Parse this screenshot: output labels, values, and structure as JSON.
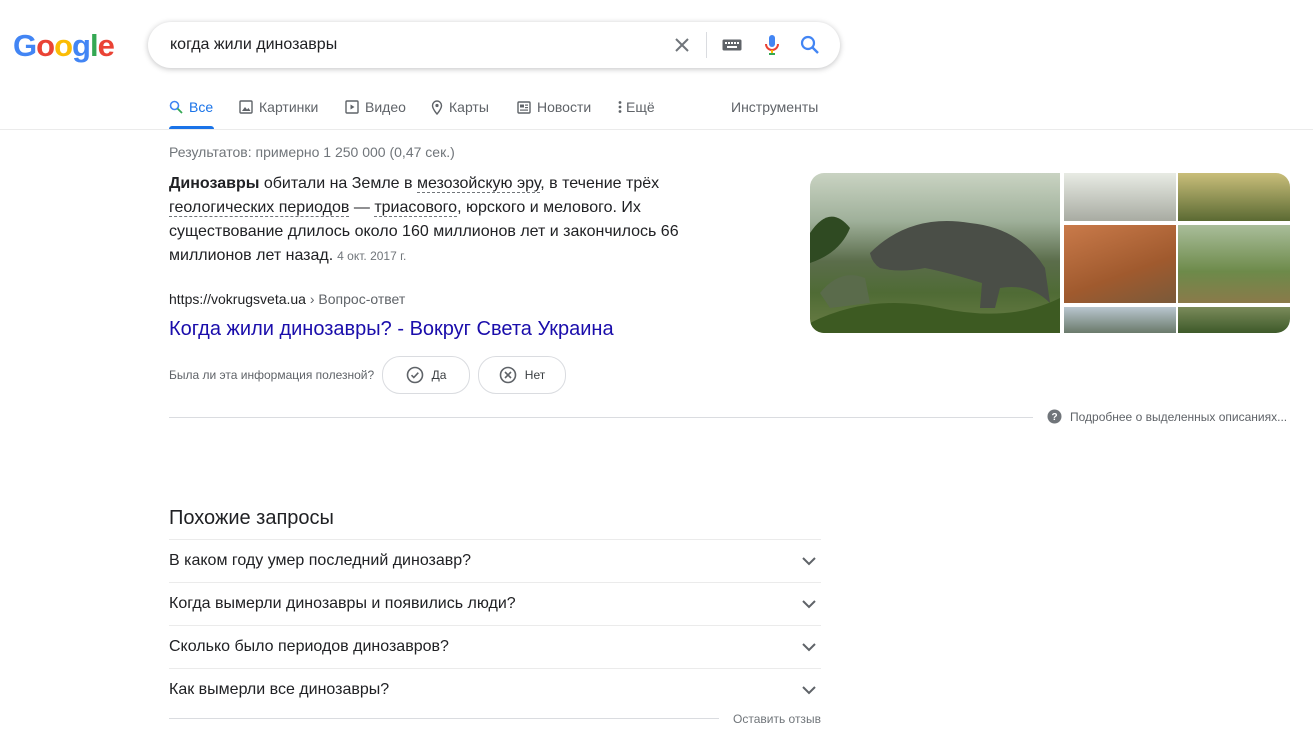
{
  "logo": {
    "letters": [
      "G",
      "o",
      "o",
      "g",
      "l",
      "e"
    ],
    "colors": [
      "#4285f4",
      "#ea4335",
      "#fbbc05",
      "#4285f4",
      "#34a853",
      "#ea4335"
    ]
  },
  "search": {
    "query": "когда жили динозавры",
    "icons": [
      "close-icon",
      "keyboard-icon",
      "mic-icon",
      "search-icon"
    ]
  },
  "tabs": [
    {
      "label": "Все",
      "icon": "search-icon",
      "active": true
    },
    {
      "label": "Картинки",
      "icon": "image-icon"
    },
    {
      "label": "Видео",
      "icon": "video-icon"
    },
    {
      "label": "Карты",
      "icon": "pin-icon"
    },
    {
      "label": "Новости",
      "icon": "news-icon"
    },
    {
      "label": "Ещё",
      "icon": "more-vert-icon"
    }
  ],
  "tools_label": "Инструменты",
  "stats": "Результатов: примерно 1 250 000 (0,47 сек.)",
  "featured": {
    "bold_term": "Динозавры",
    "text_1": " обитали на Земле в ",
    "link_1": "мезозойскую эру",
    "text_2": ", в течение трёх ",
    "link_2": "геологических периодов",
    "text_3": " — ",
    "link_3": "триасового",
    "text_4": ", юрского и мелового. Их существование длилось около 160 миллионов лет и закончилось 66 миллионов лет назад.",
    "date": "4 окт. 2017 г.",
    "cite_url": "https://vokrugsveta.ua",
    "cite_crumb": " › Вопрос-ответ",
    "title": "Когда жили динозавры? - Вокруг Света Украина"
  },
  "feedback": {
    "question": "Была ли эта информация полезной?",
    "yes": "Да",
    "no": "Нет",
    "more": "Подробнее о выделенных описаниях..."
  },
  "related": {
    "title": "Похожие запросы",
    "items": [
      "В каком году умер последний динозавр?",
      "Когда вымерли динозавры и появились люди?",
      "Сколько было периодов динозавров?",
      "Как вымерли все динозавры?"
    ],
    "feedback_link": "Оставить отзыв"
  }
}
